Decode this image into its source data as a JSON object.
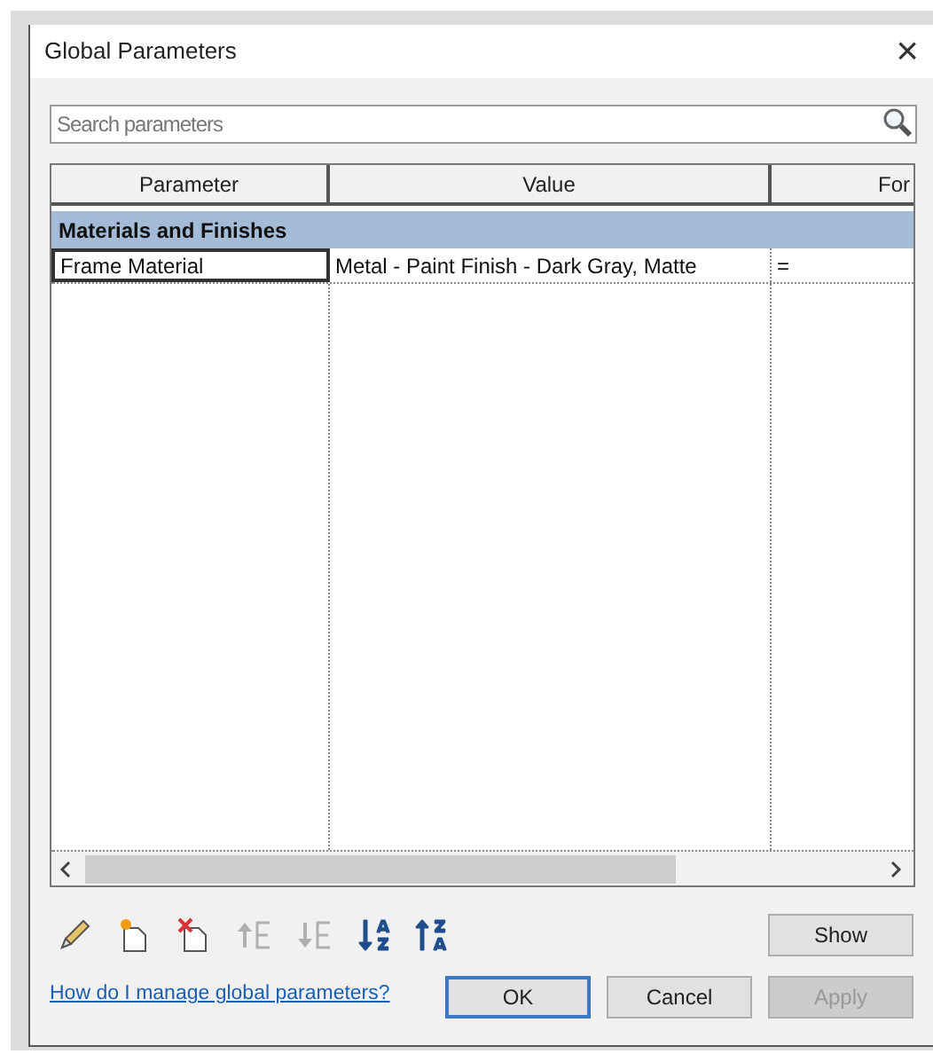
{
  "window": {
    "title": "Global Parameters",
    "close": "×"
  },
  "search": {
    "placeholder": "Search parameters"
  },
  "table": {
    "columns": [
      "Parameter",
      "Value",
      "For"
    ],
    "groups": [
      {
        "name": "Materials and Finishes",
        "rows": [
          {
            "cells": [
              "Frame Material",
              "Metal - Paint Finish - Dark Gray, Matte",
              "="
            ],
            "selected": true
          }
        ]
      }
    ]
  },
  "toolbar": [
    {
      "kind": "edit",
      "disabled": false
    },
    {
      "kind": "new",
      "disabled": false
    },
    {
      "kind": "delete",
      "disabled": false
    },
    {
      "kind": "up",
      "disabled": true
    },
    {
      "kind": "down",
      "disabled": true
    },
    {
      "kind": "sort-asc",
      "disabled": false
    },
    {
      "kind": "sort-desc",
      "disabled": false
    }
  ],
  "show_button": "Show",
  "help_link": "How do I manage global parameters?",
  "buttons": [
    {
      "label": "OK",
      "default": true,
      "disabled": false
    },
    {
      "label": "Cancel",
      "default": false,
      "disabled": false
    },
    {
      "label": "Apply",
      "default": false,
      "disabled": true
    }
  ]
}
